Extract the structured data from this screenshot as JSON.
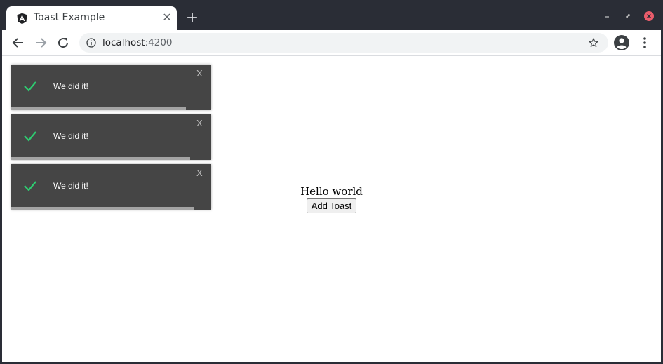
{
  "browser": {
    "tab_title": "Toast Example",
    "tab_close": "✕",
    "new_tab": "+",
    "url_host": "localhost",
    "url_port": ":4200"
  },
  "colors": {
    "check_green": "#2ecc71",
    "toast_bg": "#454545",
    "progress": "#a3a3a3"
  },
  "toasts": [
    {
      "message": "We did it!",
      "close": "X",
      "progress": 0.875
    },
    {
      "message": "We did it!",
      "close": "X",
      "progress": 0.893
    },
    {
      "message": "We did it!",
      "close": "X",
      "progress": 0.911
    }
  ],
  "main": {
    "heading": "Hello world",
    "button_label": "Add Toast"
  }
}
